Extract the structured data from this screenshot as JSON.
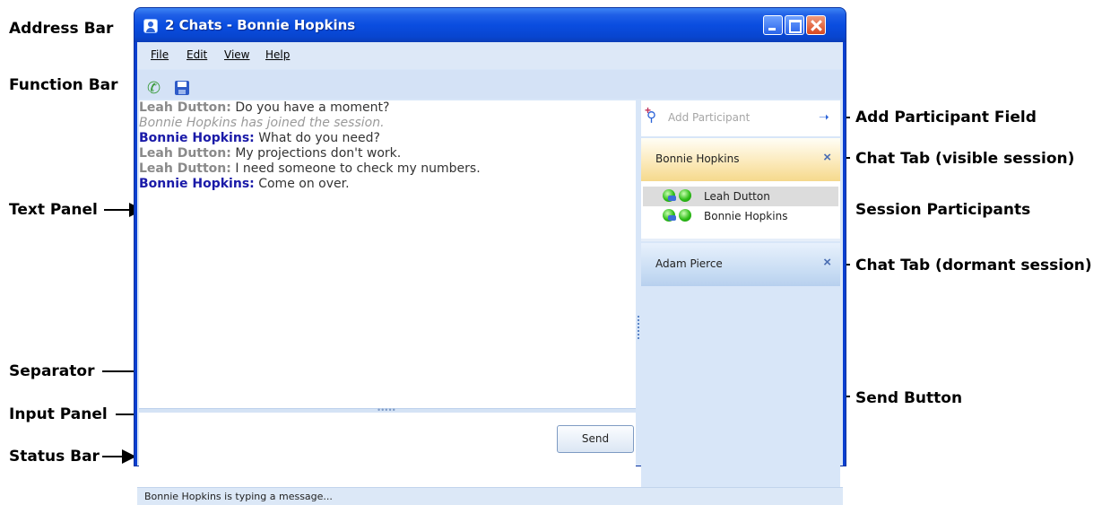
{
  "window": {
    "title": "2 Chats - Bonnie Hopkins"
  },
  "menu": {
    "items": [
      "File",
      "Edit",
      "View",
      "Help"
    ]
  },
  "toolbar": {
    "icons": [
      "phone-icon",
      "save-icon"
    ]
  },
  "messages": [
    {
      "speaker": "Leah Dutton:",
      "text": " Do you have a moment?",
      "style": "leah"
    },
    {
      "speaker": "",
      "text": "Bonnie Hopkins has joined the session.",
      "style": "sys"
    },
    {
      "speaker": "Bonnie Hopkins:",
      "text": " What do you need?",
      "style": "bonnie"
    },
    {
      "speaker": "Leah Dutton:",
      "text": " My projections don't work.",
      "style": "leah"
    },
    {
      "speaker": "Leah Dutton:",
      "text": " I need someone to check my numbers.",
      "style": "leah"
    },
    {
      "speaker": "Bonnie Hopkins:",
      "text": " Come on over.",
      "style": "bonnie"
    }
  ],
  "send_button": "Send",
  "add_participant": {
    "placeholder": "Add Participant"
  },
  "tabs": {
    "active": "Bonnie Hopkins",
    "dormant": "Adam Pierce",
    "close_glyph": "×"
  },
  "participants": [
    "Leah Dutton",
    "Bonnie Hopkins"
  ],
  "status": "Bonnie Hopkins is typing a message...",
  "annotations": {
    "address_bar": "Address Bar",
    "function_bar": "Function Bar",
    "text_panel": "Text Panel",
    "separator": "Separator",
    "input_panel": "Input Panel",
    "status_bar": "Status Bar",
    "add_participant_field": "Add Participant Field",
    "chat_tab_visible": "Chat Tab (visible session)",
    "session_participants": "Session Participants",
    "chat_tab_dormant": "Chat Tab (dormant session)",
    "send_button": "Send Button"
  },
  "colors": {
    "title_blue": "#0a4de0",
    "bonnie_name": "#1a1aa8",
    "leah_name": "#8a8a8a",
    "active_tab": "#fbe8b6"
  }
}
